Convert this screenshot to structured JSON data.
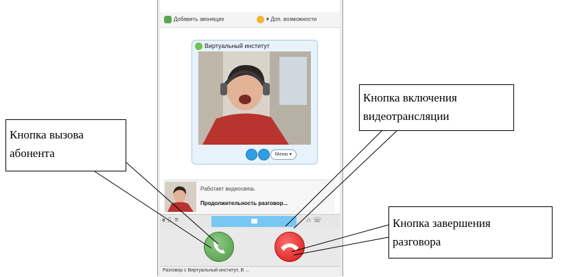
{
  "skype": {
    "toolbar": {
      "add_contact": "Добавить звонящих",
      "more_features": "Доп. возможности"
    },
    "video_card": {
      "title": "Виртуальный институт",
      "more_label": "Меню ▾"
    },
    "call_info": {
      "status": "Работает видеосвязь",
      "duration": "Продолжительность разговор..."
    },
    "status_bar": {
      "text": "Разговор с Виртуальный институт, В ..."
    },
    "colors": {
      "call_green": "#5aa64f",
      "hangup_red": "#e01b1b",
      "video_blue": "#78c6f3"
    }
  },
  "callouts": {
    "call_button": {
      "line1": "Кнопка вызова",
      "line2": "абонента"
    },
    "video_button": {
      "line1": "Кнопка включения",
      "line2": "видеотрансляции"
    },
    "end_button": {
      "line1": "Кнопка завершения",
      "line2": "разговора"
    }
  }
}
